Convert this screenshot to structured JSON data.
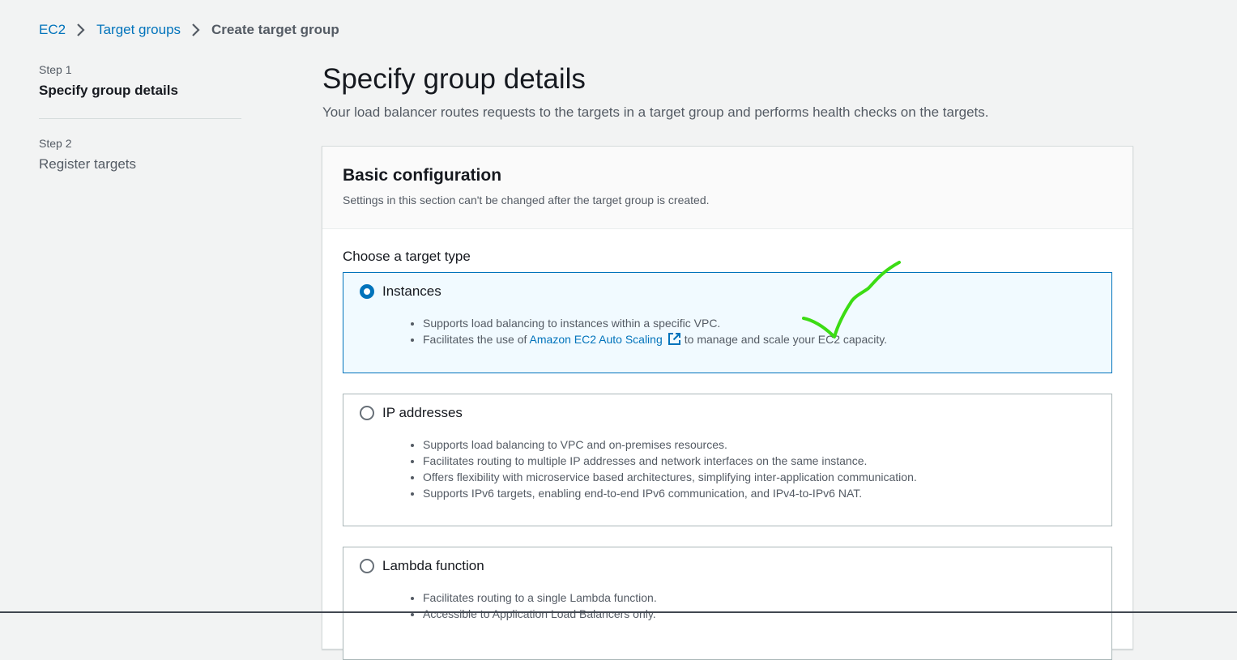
{
  "breadcrumb": {
    "items": [
      "EC2",
      "Target groups"
    ],
    "current": "Create target group"
  },
  "steps": [
    {
      "number": "Step 1",
      "title": "Specify group details"
    },
    {
      "number": "Step 2",
      "title": "Register targets"
    }
  ],
  "header": {
    "title": "Specify group details",
    "description": "Your load balancer routes requests to the targets in a target group and performs health checks on the targets."
  },
  "basic_config": {
    "title": "Basic configuration",
    "subtitle": "Settings in this section can't be changed after the target group is created.",
    "target_type_label": "Choose a target type",
    "options": [
      {
        "label": "Instances",
        "selected": true,
        "bullets": [
          "Supports load balancing to instances within a specific VPC."
        ],
        "bullet_link": {
          "prefix": "Facilitates the use of",
          "link": "Amazon EC2 Auto Scaling",
          "suffix": "to manage and scale your EC2 capacity."
        }
      },
      {
        "label": "IP addresses",
        "selected": false,
        "bullets": [
          "Supports load balancing to VPC and on-premises resources.",
          "Facilitates routing to multiple IP addresses and network interfaces on the same instance.",
          "Offers flexibility with microservice based architectures, simplifying inter-application communication.",
          "Supports IPv6 targets, enabling end-to-end IPv6 communication, and IPv4-to-IPv6 NAT."
        ]
      },
      {
        "label": "Lambda function",
        "selected": false,
        "bullets": [
          "Facilitates routing to a single Lambda function.",
          "Accessible to Application Load Balancers only."
        ]
      }
    ]
  },
  "icons": {
    "breadcrumb_separator": "chevron-right-icon",
    "external_link": "external-link-icon",
    "annotation": "checkmark-annotation"
  },
  "colors": {
    "link": "#0073bb",
    "selected_tile_bg": "#f1faff",
    "selected_border": "#0073bb",
    "annotation": "#3cdc14",
    "page_bg": "#f2f3f3"
  }
}
